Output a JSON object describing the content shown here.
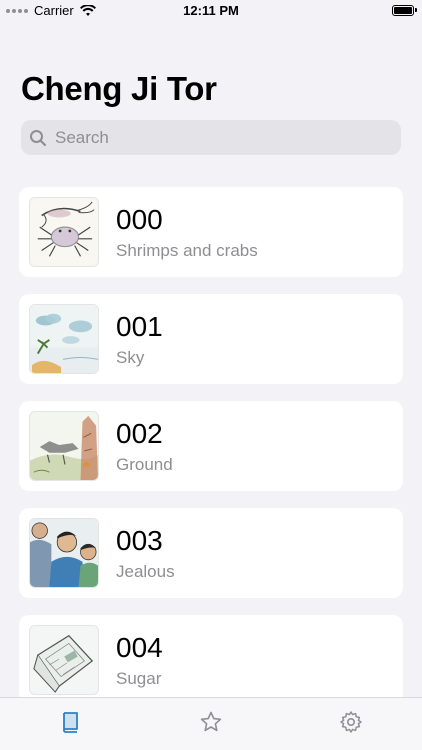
{
  "status_bar": {
    "carrier": "Carrier",
    "time": "12:11 PM"
  },
  "title": "Cheng Ji Tor",
  "search": {
    "placeholder": "Search",
    "value": ""
  },
  "items": [
    {
      "number": "000",
      "subtitle": "Shrimps and crabs",
      "thumbnail": "shrimp-crab-sketch"
    },
    {
      "number": "001",
      "subtitle": "Sky",
      "thumbnail": "sky-clouds-sketch"
    },
    {
      "number": "002",
      "subtitle": "Ground",
      "thumbnail": "ground-landscape-sketch"
    },
    {
      "number": "003",
      "subtitle": "Jealous",
      "thumbnail": "people-sketch"
    },
    {
      "number": "004",
      "subtitle": "Sugar",
      "thumbnail": "sugar-bag-sketch"
    }
  ],
  "tab_bar": {
    "tabs": [
      {
        "icon": "book-icon",
        "selected": true
      },
      {
        "icon": "star-icon",
        "selected": false
      },
      {
        "icon": "gear-icon",
        "selected": false
      }
    ],
    "accent_color": "#2f80c2",
    "inactive_color": "#8e8e93"
  }
}
